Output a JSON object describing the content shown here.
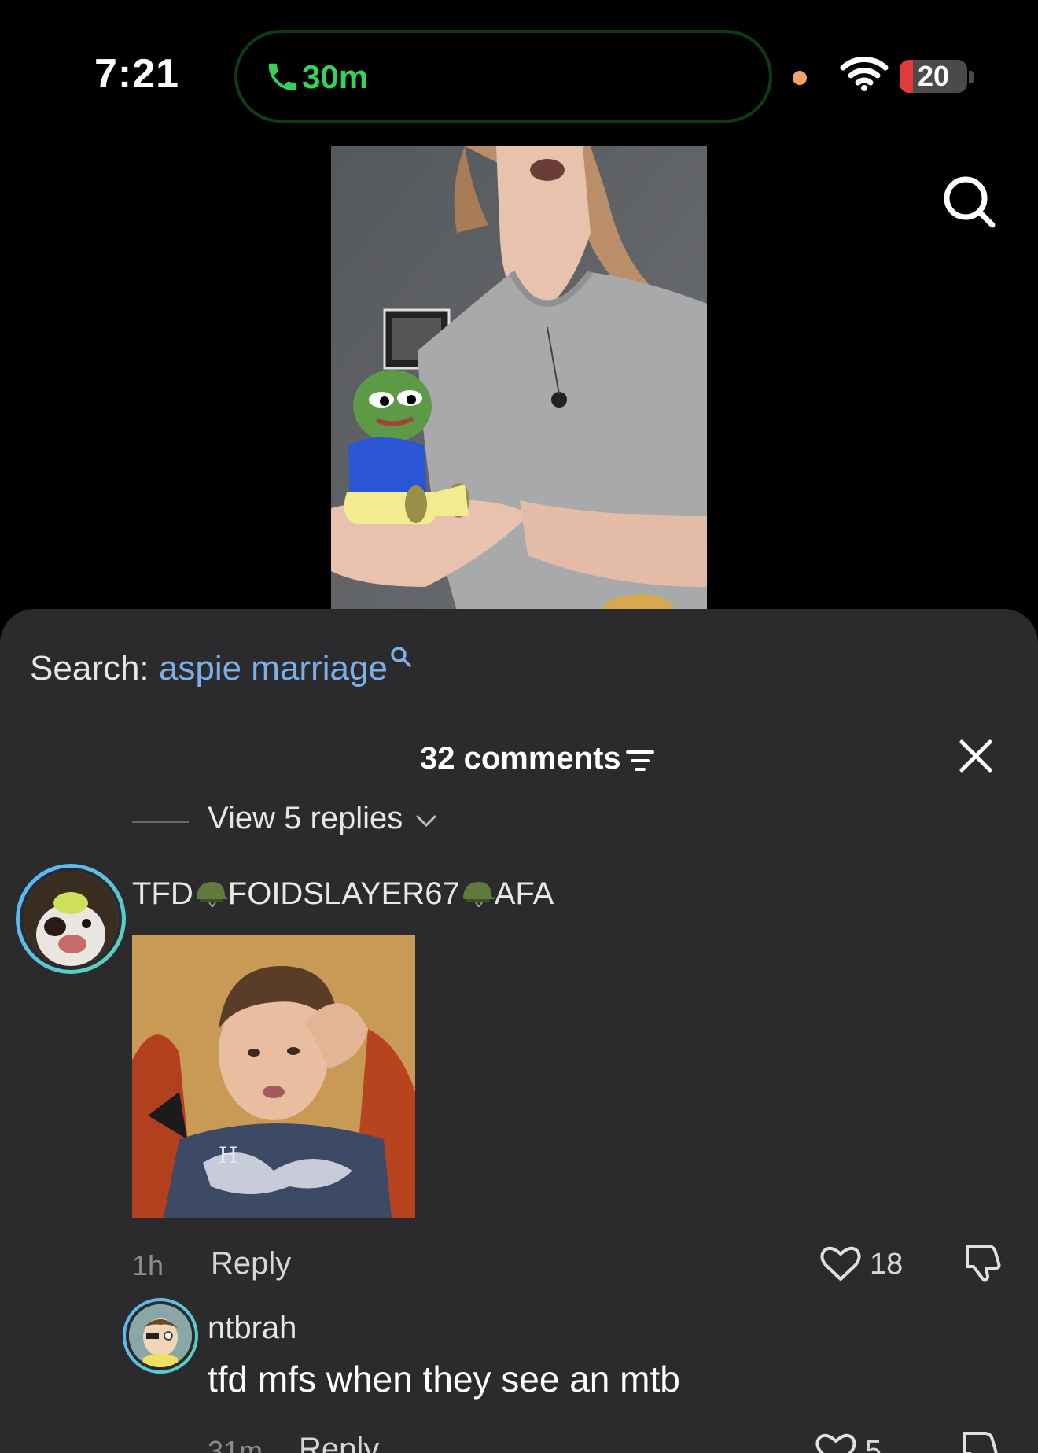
{
  "status_bar": {
    "time": "7:21",
    "call_duration": "30m",
    "battery_level": "20",
    "battery_fraction": 0.2,
    "icons": [
      "phone-icon",
      "recording-dot",
      "wifi-icon",
      "battery-icon"
    ]
  },
  "video": {
    "search_icon": "search-icon"
  },
  "sheet": {
    "search_prefix": "Search: ",
    "search_term": "aspie marriage",
    "comment_count": "32 comments",
    "view_replies": "View 5 replies",
    "comments": [
      {
        "username_parts": [
          "TFD",
          "FOIDSLAYER67",
          "AFA"
        ],
        "time": "1h",
        "reply_label": "Reply",
        "likes": "18",
        "has_image": true
      },
      {
        "username": "ntbrah",
        "text": "tfd mfs when they see an mtb",
        "time": "31m",
        "reply_label": "Reply",
        "likes": "5"
      }
    ]
  },
  "colors": {
    "sheet_bg": "#2b2b2d",
    "call_green": "#35d35a",
    "link_blue": "#7eaee6",
    "battery_red": "#e33b3b"
  }
}
